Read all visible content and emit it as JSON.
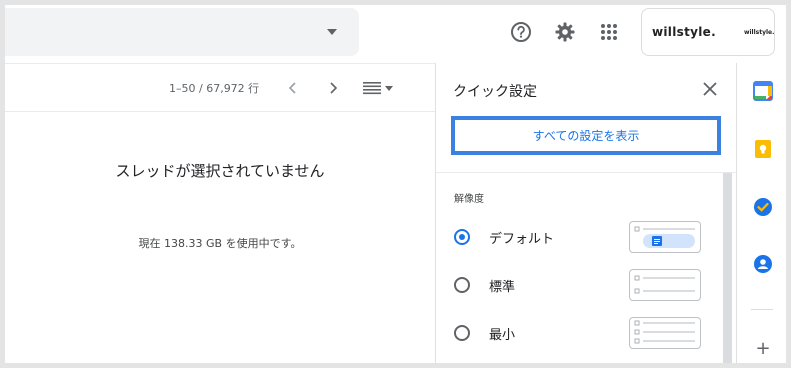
{
  "header": {
    "brand": "willstyle.",
    "brand_small": "willstyle."
  },
  "toolbar": {
    "count": "1–50 / 67,972 行"
  },
  "reading_pane": {
    "empty_message": "スレッドが選択されていません",
    "storage": "現在 138.33 GB を使用中です。"
  },
  "quick_settings": {
    "title": "クイック設定",
    "all_settings_label": "すべての設定を表示",
    "density_label": "解像度",
    "options": [
      {
        "label": "デフォルト",
        "selected": true
      },
      {
        "label": "標準",
        "selected": false
      },
      {
        "label": "最小",
        "selected": false
      }
    ]
  },
  "side_panel": {
    "calendar_day": "31",
    "add_label": "+"
  },
  "colors": {
    "accent": "#1a73e8",
    "highlight_border": "#3b82e0",
    "calendar_blue": "#4285f4",
    "keep_yellow": "#fbbc04",
    "tasks_blue": "#1a73e8",
    "contacts_blue": "#1a73e8"
  },
  "icons": [
    "chevron-down-icon",
    "help-icon",
    "gear-icon",
    "apps-grid-icon",
    "chevron-left-icon",
    "chevron-right-icon",
    "density-list-icon",
    "close-icon",
    "calendar-icon",
    "keep-icon",
    "tasks-icon",
    "contacts-icon",
    "add-icon"
  ]
}
